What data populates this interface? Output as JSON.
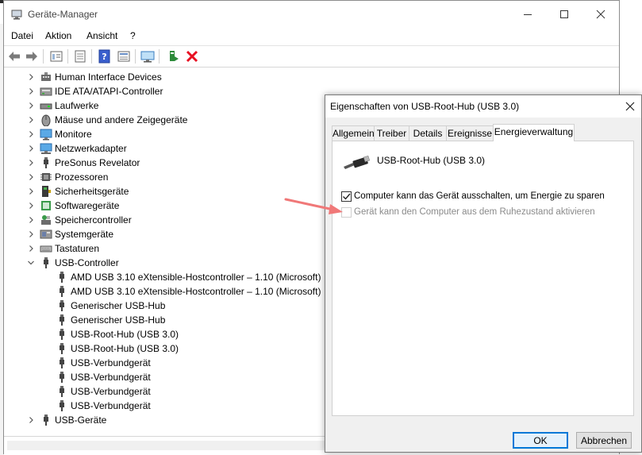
{
  "window": {
    "title": "Geräte-Manager"
  },
  "menu": [
    "Datei",
    "Aktion",
    "Ansicht",
    "?"
  ],
  "tree": [
    {
      "label": "Human Interface Devices",
      "level": 0,
      "expanded": false,
      "icon": "hid-icon"
    },
    {
      "label": "IDE ATA/ATAPI-Controller",
      "level": 0,
      "expanded": false,
      "icon": "ide-icon"
    },
    {
      "label": "Laufwerke",
      "level": 0,
      "expanded": false,
      "icon": "drive-icon"
    },
    {
      "label": "Mäuse und andere Zeigegeräte",
      "level": 0,
      "expanded": false,
      "icon": "mouse-icon"
    },
    {
      "label": "Monitore",
      "level": 0,
      "expanded": false,
      "icon": "monitor-icon"
    },
    {
      "label": "Netzwerkadapter",
      "level": 0,
      "expanded": false,
      "icon": "network-icon"
    },
    {
      "label": "PreSonus Revelator",
      "level": 0,
      "expanded": false,
      "icon": "usb-plug-icon"
    },
    {
      "label": "Prozessoren",
      "level": 0,
      "expanded": false,
      "icon": "cpu-icon"
    },
    {
      "label": "Sicherheitsgeräte",
      "level": 0,
      "expanded": false,
      "icon": "security-icon"
    },
    {
      "label": "Softwaregeräte",
      "level": 0,
      "expanded": false,
      "icon": "software-icon"
    },
    {
      "label": "Speichercontroller",
      "level": 0,
      "expanded": false,
      "icon": "storage-icon"
    },
    {
      "label": "Systemgeräte",
      "level": 0,
      "expanded": false,
      "icon": "system-icon"
    },
    {
      "label": "Tastaturen",
      "level": 0,
      "expanded": false,
      "icon": "keyboard-icon"
    },
    {
      "label": "USB-Controller",
      "level": 0,
      "expanded": true,
      "icon": "usb-plug-icon"
    },
    {
      "label": "AMD USB 3.10 eXtensible-Hostcontroller – 1.10 (Microsoft)",
      "level": 1,
      "icon": "usb-plug-icon"
    },
    {
      "label": "AMD USB 3.10 eXtensible-Hostcontroller – 1.10 (Microsoft)",
      "level": 1,
      "icon": "usb-plug-icon"
    },
    {
      "label": "Generischer USB-Hub",
      "level": 1,
      "icon": "usb-plug-icon"
    },
    {
      "label": "Generischer USB-Hub",
      "level": 1,
      "icon": "usb-plug-icon"
    },
    {
      "label": "USB-Root-Hub (USB 3.0)",
      "level": 1,
      "icon": "usb-plug-icon"
    },
    {
      "label": "USB-Root-Hub (USB 3.0)",
      "level": 1,
      "icon": "usb-plug-icon"
    },
    {
      "label": "USB-Verbundgerät",
      "level": 1,
      "icon": "usb-plug-icon"
    },
    {
      "label": "USB-Verbundgerät",
      "level": 1,
      "icon": "usb-plug-icon"
    },
    {
      "label": "USB-Verbundgerät",
      "level": 1,
      "icon": "usb-plug-icon"
    },
    {
      "label": "USB-Verbundgerät",
      "level": 1,
      "icon": "usb-plug-icon"
    },
    {
      "label": "USB-Geräte",
      "level": 0,
      "expanded": false,
      "icon": "usb-plug-icon"
    }
  ],
  "dialog": {
    "title": "Eigenschaften von USB-Root-Hub (USB 3.0)",
    "tabs": [
      "Allgemein",
      "Treiber",
      "Details",
      "Ereignisse",
      "Energieverwaltung"
    ],
    "active_tab": "Energieverwaltung",
    "device_name": "USB-Root-Hub (USB 3.0)",
    "options": [
      {
        "label": "Computer kann das Gerät ausschalten, um Energie zu sparen",
        "checked": true,
        "enabled": true
      },
      {
        "label": "Gerät kann den Computer aus dem Ruhezustand aktivieren",
        "checked": false,
        "enabled": false
      }
    ],
    "ok_label": "OK",
    "cancel_label": "Abbrechen"
  },
  "colors": {
    "accent": "#0078d7",
    "annotation_arrow": "#f07878",
    "close_red": "#e81123"
  }
}
